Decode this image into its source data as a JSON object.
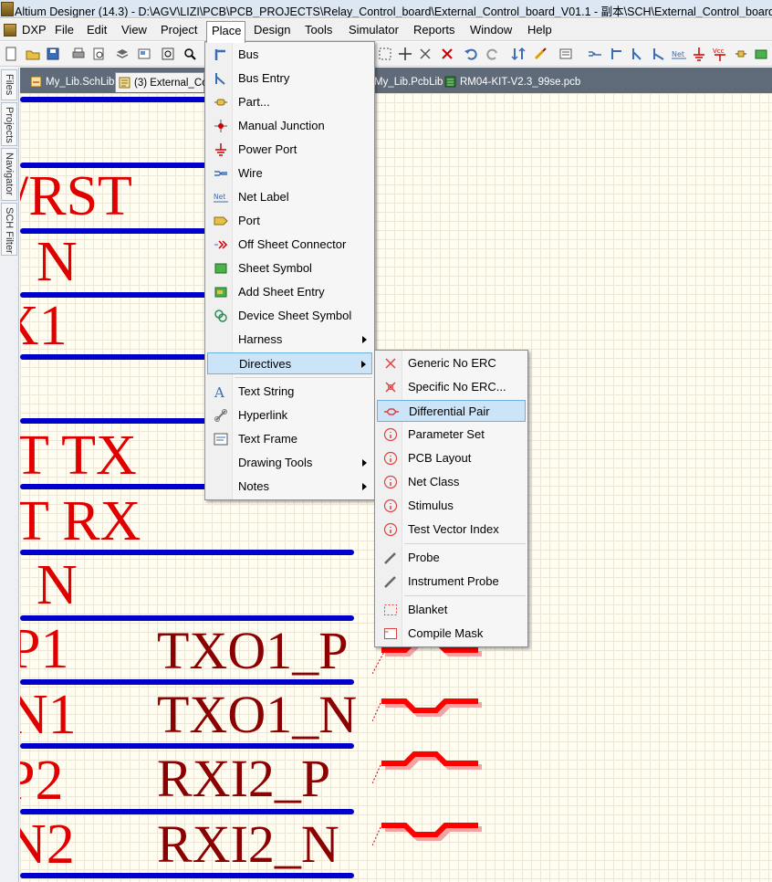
{
  "window": {
    "title": "Altium Designer (14.3) - D:\\AGV\\LIZI\\PCB\\PCB_PROJECTS\\Relay_Control_board\\External_Control_board_V01.1 - 副本\\SCH\\External_Control_board"
  },
  "menubar": {
    "dxp": "DXP",
    "file": "File",
    "edit": "Edit",
    "view": "View",
    "project": "Project",
    "place": "Place",
    "design": "Design",
    "tools": "Tools",
    "simulator": "Simulator",
    "reports": "Reports",
    "window": "Window",
    "help": "Help"
  },
  "side_tabs": {
    "files": "Files",
    "projects": "Projects",
    "navigator": "Navigator",
    "sch_filter": "SCH Filter"
  },
  "doc_tabs": {
    "t1": "My_Lib.SchLib",
    "t2": "(3) External_Co",
    "t3": "My_Lib.PcbLib",
    "t4": "RM04-KIT-V2.3_99se.pcb"
  },
  "place_menu": {
    "bus": "Bus",
    "bus_entry": "Bus Entry",
    "part": "Part...",
    "manual_junction": "Manual Junction",
    "power_port": "Power Port",
    "wire": "Wire",
    "net_label": "Net Label",
    "port": "Port",
    "off_sheet_connector": "Off Sheet Connector",
    "sheet_symbol": "Sheet Symbol",
    "add_sheet_entry": "Add Sheet Entry",
    "device_sheet_symbol": "Device Sheet Symbol",
    "harness": "Harness",
    "directives": "Directives",
    "text_string": "Text String",
    "hyperlink": "Hyperlink",
    "text_frame": "Text Frame",
    "drawing_tools": "Drawing Tools",
    "notes": "Notes"
  },
  "directives_menu": {
    "generic_no_erc": "Generic No ERC",
    "specific_no_erc": "Specific No ERC...",
    "differential_pair": "Differential Pair",
    "parameter_set": "Parameter Set",
    "pcb_layout": "PCB Layout",
    "net_class": "Net Class",
    "stimulus": "Stimulus",
    "test_vector_index": "Test Vector Index",
    "probe": "Probe",
    "instrument_probe": "Instrument Probe",
    "blanket": "Blanket",
    "compile_mask": "Compile Mask"
  },
  "schematic": {
    "labels": {
      "rst": "/RST",
      "n1": "N",
      "x1": "X1",
      "t_tx": "T  TX",
      "t_rx": "T  RX",
      "n2": "N",
      "p1": "P1",
      "n_1": "N1",
      "p2": "P2",
      "n_2": "N2"
    },
    "nets": {
      "txo1_p": "TXO1_P",
      "txo1_n": "TXO1_N",
      "rxi2_p": "RXI2_P",
      "rxi2_n": "RXI2_N"
    }
  },
  "colors": {
    "wire": "#0000cc",
    "label_red": "#e00000",
    "net_dark_red": "#8b0000",
    "diff_pair": "#ff0000",
    "menu_highlight": "#cce4f7",
    "canvas": "#fffcf2"
  }
}
